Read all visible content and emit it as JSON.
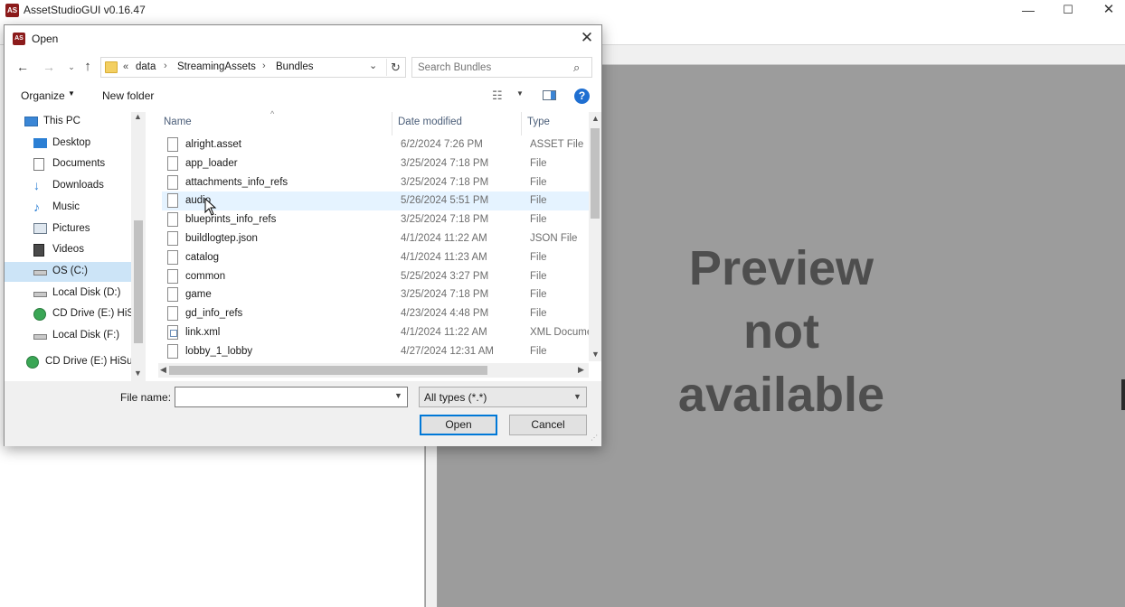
{
  "app": {
    "title": "AssetStudioGUI v0.16.47",
    "logo_text": "AS",
    "window_controls": {
      "minimize": "—",
      "maximize": "☐",
      "close": "✕"
    },
    "preview_message": "Preview not available"
  },
  "dialog": {
    "title": "Open",
    "close": "✕",
    "nav": {
      "back": "←",
      "forward": "→",
      "recent": "⌄",
      "up": "↑",
      "refresh": "↻",
      "dropdown": "⌄"
    },
    "address": {
      "overflow": "«",
      "crumbs": [
        "data",
        "StreamingAssets",
        "Bundles"
      ],
      "separator": "›"
    },
    "search": {
      "placeholder": "Search Bundles"
    },
    "toolbar": {
      "organize": "Organize",
      "new_folder": "New folder",
      "help": "?"
    },
    "nav_pane": [
      {
        "label": "This PC",
        "icon": "monitor-icon"
      },
      {
        "label": "Desktop",
        "icon": "desktop-icon"
      },
      {
        "label": "Documents",
        "icon": "document-icon"
      },
      {
        "label": "Downloads",
        "icon": "download-icon"
      },
      {
        "label": "Music",
        "icon": "music-icon"
      },
      {
        "label": "Pictures",
        "icon": "picture-icon"
      },
      {
        "label": "Videos",
        "icon": "video-icon"
      },
      {
        "label": "OS (C:)",
        "icon": "drive-icon",
        "selected": true
      },
      {
        "label": "Local Disk (D:)",
        "icon": "drive-icon"
      },
      {
        "label": "CD Drive (E:) HiS",
        "icon": "cd-icon"
      },
      {
        "label": "Local Disk (F:)",
        "icon": "drive-icon"
      },
      {
        "label": "CD Drive (E:) HiSu",
        "icon": "cd-icon"
      }
    ],
    "columns": {
      "name": "Name",
      "date": "Date modified",
      "type": "Type"
    },
    "files": [
      {
        "name": "alright.asset",
        "date": "6/2/2024 7:26 PM",
        "type": "ASSET File"
      },
      {
        "name": "app_loader",
        "date": "3/25/2024 7:18 PM",
        "type": "File"
      },
      {
        "name": "attachments_info_refs",
        "date": "3/25/2024 7:18 PM",
        "type": "File"
      },
      {
        "name": "audio",
        "date": "5/26/2024 5:51 PM",
        "type": "File",
        "hover": true
      },
      {
        "name": "blueprints_info_refs",
        "date": "3/25/2024 7:18 PM",
        "type": "File"
      },
      {
        "name": "buildlogtep.json",
        "date": "4/1/2024 11:22 AM",
        "type": "JSON File"
      },
      {
        "name": "catalog",
        "date": "4/1/2024 11:23 AM",
        "type": "File"
      },
      {
        "name": "common",
        "date": "5/25/2024 3:27 PM",
        "type": "File"
      },
      {
        "name": "game",
        "date": "3/25/2024 7:18 PM",
        "type": "File"
      },
      {
        "name": "gd_info_refs",
        "date": "4/23/2024 4:48 PM",
        "type": "File"
      },
      {
        "name": "link.xml",
        "date": "4/1/2024 11:22 AM",
        "type": "XML Docume",
        "xml": true
      },
      {
        "name": "lobby_1_lobby",
        "date": "4/27/2024 12:31 AM",
        "type": "File"
      }
    ],
    "file_name": {
      "label": "File name:",
      "value": ""
    },
    "file_type": {
      "selected": "All types (*.*)"
    },
    "buttons": {
      "open": "Open",
      "cancel": "Cancel"
    }
  }
}
